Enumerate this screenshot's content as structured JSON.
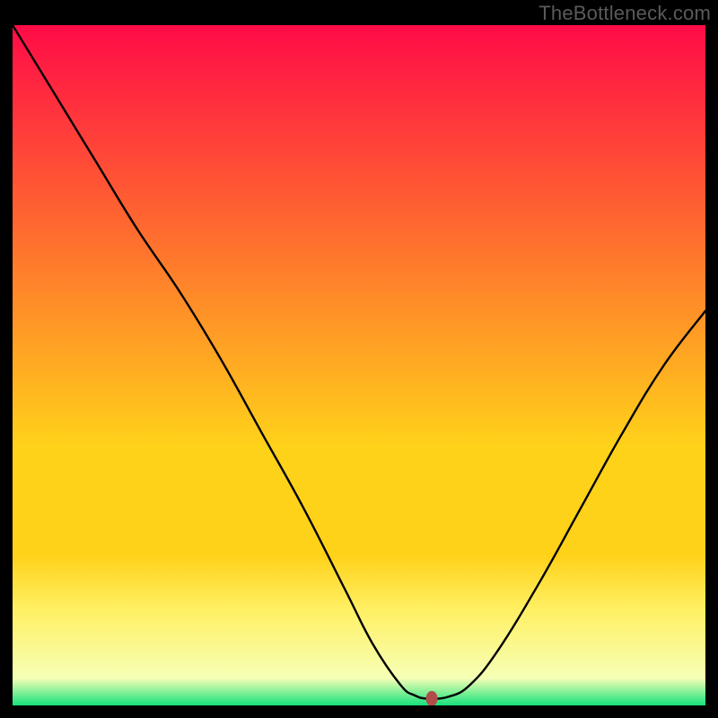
{
  "watermark": "TheBottleneck.com",
  "colors": {
    "frame_bg": "#000000",
    "curve_stroke": "#000000",
    "marker_fill": "#b24c49",
    "gradient_top": "#ff0b47",
    "gradient_mid1": "#ff6a2f",
    "gradient_mid2": "#ffd21a",
    "gradient_mid3": "#fff064",
    "gradient_band_pale": "#f6ffb5",
    "gradient_bottom": "#15e27b"
  },
  "chart_data": {
    "type": "line",
    "title": "",
    "xlabel": "",
    "ylabel": "",
    "xlim": [
      0,
      100
    ],
    "ylim": [
      0,
      100
    ],
    "curve": {
      "x": [
        0,
        6,
        12,
        18,
        24,
        30,
        36,
        42,
        48,
        52,
        56,
        58,
        60,
        63,
        66,
        70,
        76,
        82,
        88,
        94,
        100
      ],
      "y": [
        100,
        90,
        80,
        70,
        61,
        51,
        40,
        29,
        17,
        9,
        3,
        1.5,
        1,
        1.3,
        3,
        8,
        18,
        29,
        40,
        50,
        58
      ]
    },
    "marker": {
      "x": 60.5,
      "y": 1.0
    },
    "gradient_bands_pct_from_top": {
      "red_to_orange": 30,
      "orange_to_yellow": 62,
      "yellow_plateau_top": 78,
      "pale_band_top": 86,
      "green_top": 96
    }
  }
}
